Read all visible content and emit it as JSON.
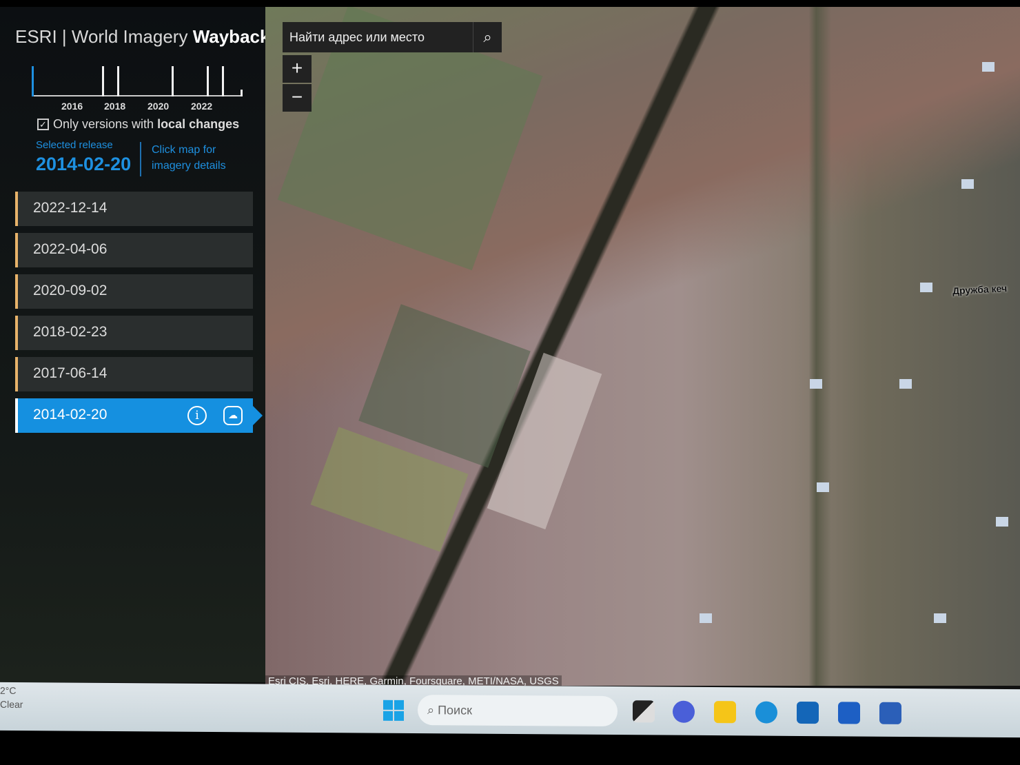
{
  "app": {
    "title_prefix": "ESRI | World Imagery ",
    "title_bold": "Wayback"
  },
  "timeline": {
    "years": [
      "2016",
      "2018",
      "2020",
      "2022"
    ],
    "selected_release": "2014-02-20"
  },
  "filter": {
    "label_prefix": "Only versions with ",
    "label_bold": "local changes",
    "checked": true
  },
  "selected": {
    "label": "Selected release",
    "date": "2014-02-20"
  },
  "hint": "Click map for imagery details",
  "releases": [
    {
      "date": "2022-12-14"
    },
    {
      "date": "2022-04-06"
    },
    {
      "date": "2020-09-02"
    },
    {
      "date": "2018-02-23"
    },
    {
      "date": "2017-06-14"
    },
    {
      "date": "2014-02-20",
      "active": true
    }
  ],
  "map": {
    "search_placeholder": "Найти адрес или место",
    "zoom_in": "+",
    "zoom_out": "−",
    "road_label": "Дружба кеч",
    "attribution": "Esri CIS, Esri, HERE, Garmin, Foursquare, METI/NASA, USGS"
  },
  "taskbar": {
    "weather_temp": "2°C",
    "weather_desc": "Clear",
    "search_placeholder": "Поиск",
    "apps": [
      "task-view",
      "meet",
      "file-explorer",
      "edge",
      "store",
      "scanner",
      "word"
    ]
  },
  "colors": {
    "accent": "#1590e0"
  }
}
